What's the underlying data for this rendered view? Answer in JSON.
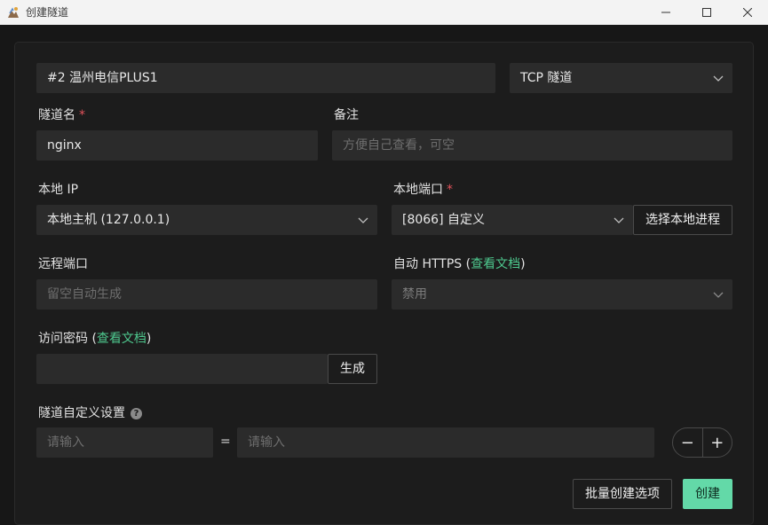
{
  "window": {
    "title": "创建隧道",
    "minimize_icon": "minimize-icon",
    "maximize_icon": "maximize-icon",
    "close_icon": "close-icon"
  },
  "node_select": {
    "value": "#2 温州电信PLUS1"
  },
  "type_select": {
    "value": "TCP 隧道"
  },
  "tunnel_name": {
    "label": "隧道名",
    "required_mark": "*",
    "value": "nginx"
  },
  "note": {
    "label": "备注",
    "placeholder": "方便自己查看，可空"
  },
  "local_ip": {
    "label": "本地 IP",
    "value": "本地主机 (127.0.0.1)"
  },
  "local_port": {
    "label": "本地端口",
    "required_mark": "*",
    "value": "[8066] 自定义",
    "pick_process_label": "选择本地进程"
  },
  "remote_port": {
    "label": "远程端口",
    "placeholder": "留空自动生成"
  },
  "auto_https": {
    "label": "自动 HTTPS (",
    "link": "查看文档",
    "label_end": ")",
    "value": "禁用"
  },
  "access_password": {
    "label": "访问密码 (",
    "link": "查看文档",
    "label_end": ")",
    "value": "",
    "generate_label": "生成"
  },
  "custom_settings": {
    "label": "隧道自定义设置",
    "help_glyph": "?",
    "key_placeholder": "请输入",
    "equals": "=",
    "value_placeholder": "请输入",
    "minus": "−",
    "plus": "+"
  },
  "footer": {
    "batch_label": "批量创建选项",
    "create_label": "创建"
  },
  "colors": {
    "accent": "#63d9a8",
    "link": "#4ec88e",
    "required": "#e2525b",
    "background": "#1c1c1c",
    "field": "#2b2b2b"
  }
}
